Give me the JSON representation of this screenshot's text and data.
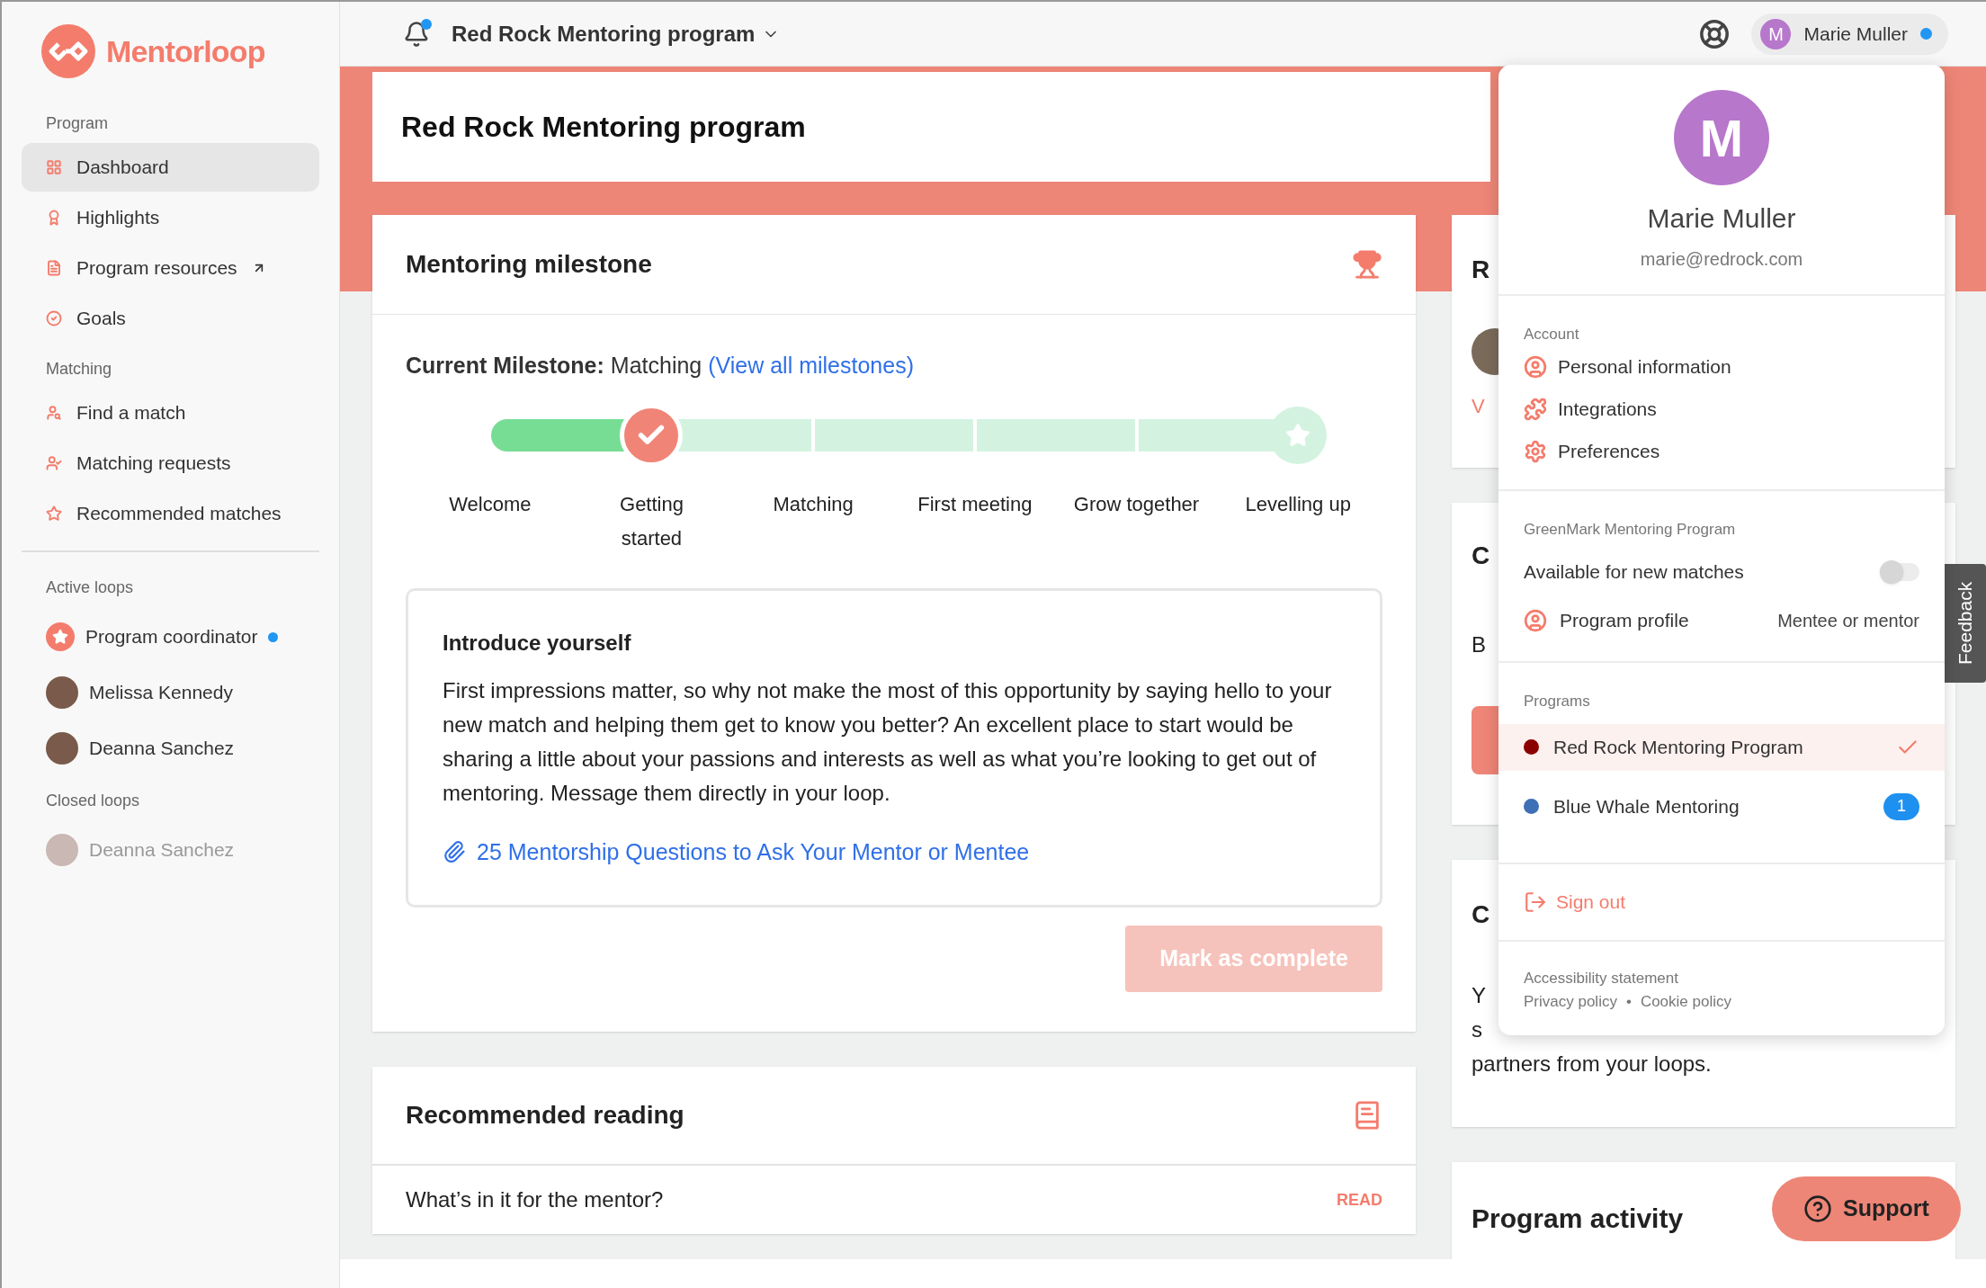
{
  "sidebar": {
    "logo": "Mentorloop",
    "sections": [
      {
        "heading": "Program",
        "items": [
          {
            "label": "Dashboard",
            "selected": true,
            "external": false
          },
          {
            "label": "Highlights",
            "selected": false,
            "external": false
          },
          {
            "label": "Program resources",
            "selected": false,
            "external": true
          },
          {
            "label": "Goals",
            "selected": false,
            "external": false
          }
        ]
      },
      {
        "heading": "Matching",
        "items": [
          {
            "label": "Find a match",
            "selected": false,
            "external": false
          },
          {
            "label": "Matching requests",
            "selected": false,
            "external": false
          },
          {
            "label": "Recommended matches",
            "selected": false,
            "external": false
          }
        ]
      }
    ],
    "loop_groups": [
      {
        "heading": "Active loops",
        "closed": false,
        "loops": [
          {
            "name": "Program coordinator",
            "kind": "coordinator",
            "unread": true
          },
          {
            "name": "Melissa Kennedy",
            "kind": "person",
            "unread": false
          },
          {
            "name": "Deanna Sanchez",
            "kind": "person",
            "unread": false
          }
        ]
      },
      {
        "heading": "Closed loops",
        "closed": true,
        "loops": [
          {
            "name": "Deanna Sanchez",
            "kind": "person",
            "unread": false
          }
        ]
      }
    ]
  },
  "top_bar": {
    "notifications": true,
    "program": "Red Rock Mentoring program",
    "user": {
      "initial": "M",
      "name": "Marie Muller",
      "online": true
    }
  },
  "page_title": "Red Rock Mentoring program",
  "milestone_card": {
    "title": "Mentoring milestone",
    "current": "**Current Milestone:** Matching",
    "link": "(View all milestones)",
    "steps": [
      {
        "label": "Welcome",
        "kind": "plain",
        "complete": true
      },
      {
        "label": "Getting started",
        "kind": "check",
        "complete": false
      },
      {
        "label": "Matching",
        "kind": "plain",
        "complete": false
      },
      {
        "label": "First meeting",
        "kind": "plain",
        "complete": false
      },
      {
        "label": "Grow together",
        "kind": "plain",
        "complete": false
      },
      {
        "label": "Levelling up",
        "kind": "star",
        "complete": false
      }
    ],
    "task": {
      "title": "Introduce yourself",
      "body": "First impressions matter, so why not make the most of this opportunity by saying hello to your new match and helping them get to know you better? An excellent place to start would be sharing a little about your passions and interests as well as what you’re looking to get out of mentoring. Message them directly in your loop.",
      "attachment": "25 Mentorship Questions to Ask Your Mentor or Mentee"
    },
    "button": {
      "label": "Mark as complete",
      "disabled": true
    }
  },
  "reading_card": {
    "title": "Recommended reading",
    "items": [
      {
        "title": "What’s in it for the mentor?",
        "action": "READ"
      }
    ]
  },
  "right_cards": [
    {
      "kind": "loop",
      "title": "R",
      "link": "V"
    },
    {
      "kind": "action",
      "title": "C",
      "lines": [
        "B"
      ]
    },
    {
      "kind": "text",
      "title": "C",
      "lines": [
        "Y",
        "s",
        "partners from your loops."
      ]
    },
    {
      "kind": "activity",
      "title": "Program activity"
    }
  ],
  "support_button": "Support",
  "feedback_tab": "Feedback",
  "user_menu": {
    "initial": "M",
    "name": "Marie Muller",
    "email": "marie@redrock.com",
    "account": {
      "heading": "Account",
      "items": [
        "Personal information",
        "Integrations",
        "Preferences"
      ]
    },
    "program_settings": {
      "heading": "GreenMark Mentoring Program",
      "availability": {
        "label": "Available for new matches",
        "on": false
      },
      "profile": {
        "label": "Program profile",
        "value": "Mentee or mentor"
      }
    },
    "programs": {
      "heading": "Programs",
      "items": [
        {
          "name": "Red Rock Mentoring Program",
          "color": "#8b0000",
          "selected": true
        },
        {
          "name": "Blue Whale Mentoring",
          "color": "#3f6fb5",
          "selected": false,
          "badge": "1"
        }
      ]
    },
    "sign_out": "Sign out",
    "footer": {
      "accessibility": "Accessibility statement",
      "privacy": "Privacy policy",
      "separator": "•",
      "cookie": "Cookie policy"
    }
  }
}
